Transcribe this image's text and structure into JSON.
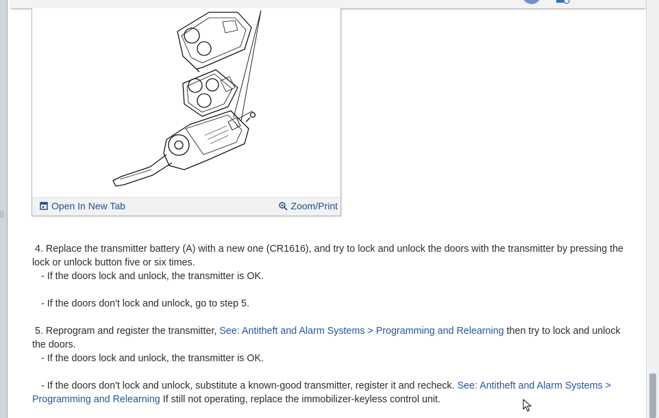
{
  "figure": {
    "open_tab_label": "Open In New Tab",
    "zoom_label": "Zoom/Print"
  },
  "steps": {
    "step4": {
      "text": "4. Replace the transmitter battery (A) with a new one (CR1616), and try to lock and unlock the doors with the transmitter by pressing the lock or unlock button five or six times.",
      "sub1": "-  If the doors lock and unlock, the transmitter is OK.",
      "sub2": "-  If the doors don't lock and unlock, go to step 5."
    },
    "step5": {
      "prefix": "5. Reprogram and register the transmitter, ",
      "link": "See: Antitheft and Alarm Systems > Programming and Relearning",
      "suffix": " then try to lock and unlock the doors.",
      "sub1": "-  If the doors lock and unlock, the transmitter is OK.",
      "sub2_prefix": "-  If the doors don't lock and unlock, substitute a known-good transmitter, register it and recheck. ",
      "sub2_link": "See: Antitheft and Alarm Systems > Programming and Relearning",
      "sub2_suffix": " If still not operating, replace the immobilizer-keyless control unit."
    }
  },
  "colors": {
    "link": "#24579a",
    "text": "#2b2b2b",
    "footer_bg": "#f2f2f2"
  },
  "icons": [
    "open-new-tab-icon",
    "zoom-icon",
    "mouse-cursor-icon",
    "avatar"
  ]
}
